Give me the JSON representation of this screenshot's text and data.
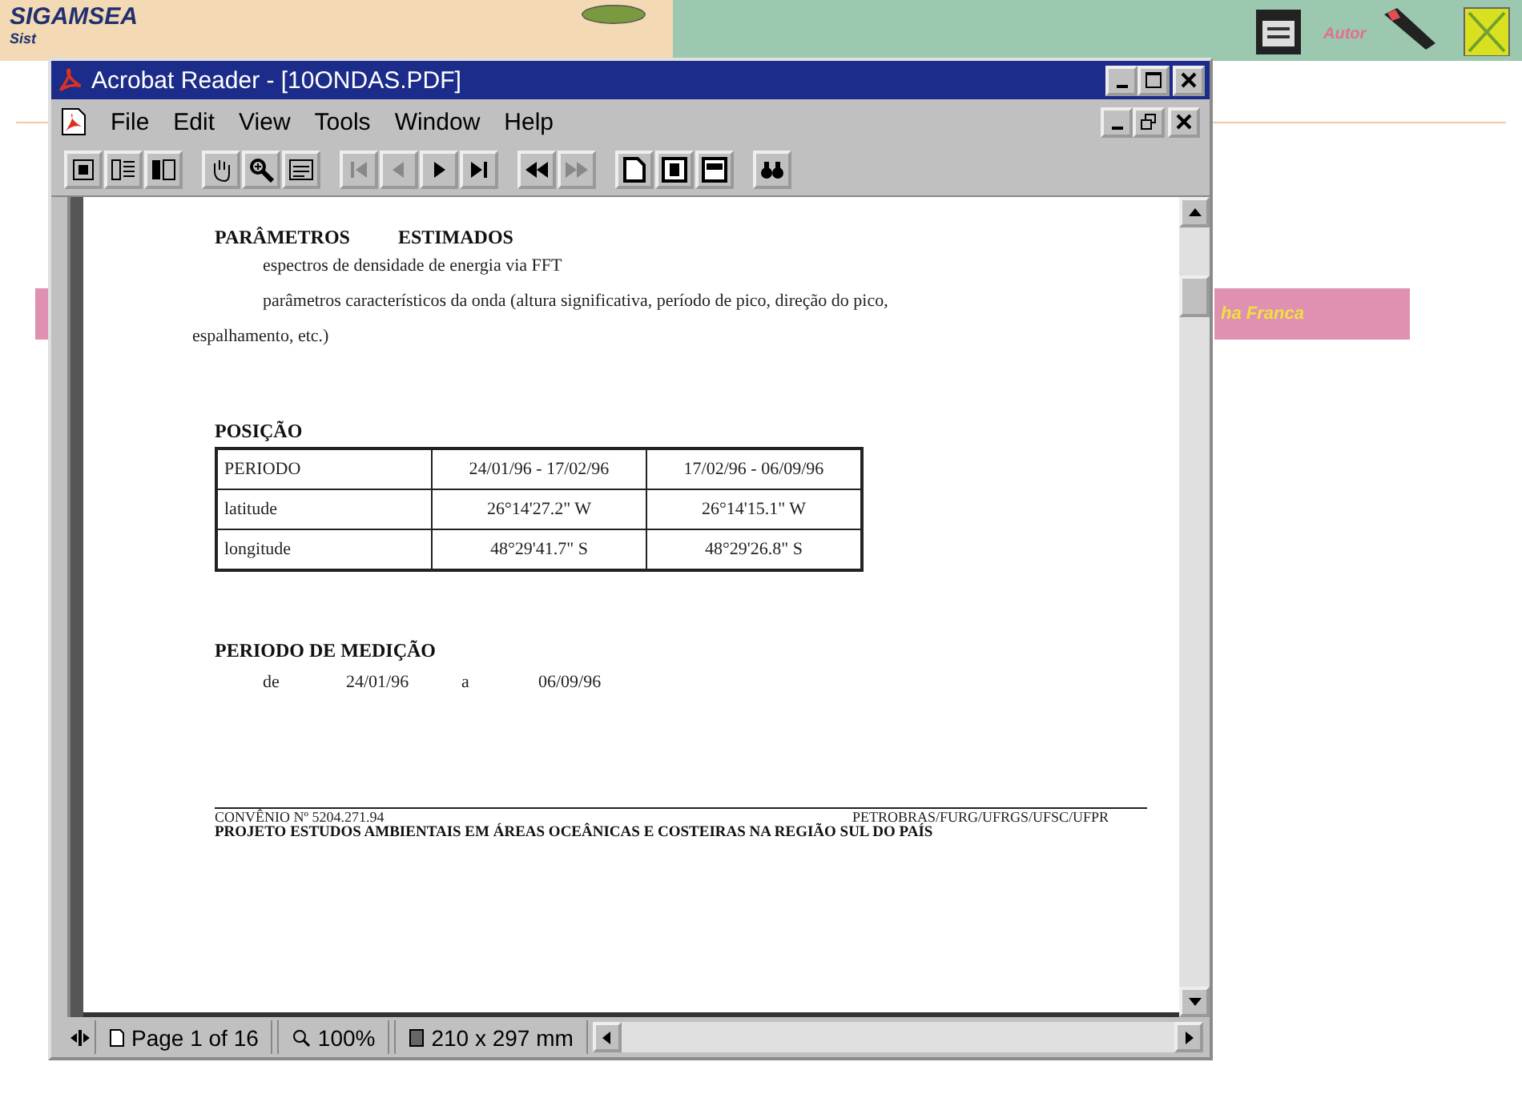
{
  "background_app": {
    "title": "SIGAMSEA",
    "subtitle": "Sist",
    "right_banner": "ha Franca",
    "author_label": "Autor"
  },
  "window": {
    "title": "Acrobat Reader - [10ONDAS.PDF]"
  },
  "menu": [
    "File",
    "Edit",
    "View",
    "Tools",
    "Window",
    "Help"
  ],
  "toolbar": [
    {
      "kind": "page-only",
      "disabled": false
    },
    {
      "kind": "bookmarks",
      "disabled": false
    },
    {
      "kind": "thumbnails",
      "disabled": false
    },
    {
      "kind": "hand",
      "disabled": false
    },
    {
      "kind": "zoom",
      "disabled": false
    },
    {
      "kind": "select-text",
      "disabled": false
    },
    {
      "kind": "first",
      "disabled": true
    },
    {
      "kind": "prev",
      "disabled": true
    },
    {
      "kind": "next",
      "disabled": false
    },
    {
      "kind": "last",
      "disabled": false
    },
    {
      "kind": "back",
      "disabled": false
    },
    {
      "kind": "forward",
      "disabled": true
    },
    {
      "kind": "actual-size",
      "disabled": false
    },
    {
      "kind": "fit-page",
      "disabled": false
    },
    {
      "kind": "fit-width",
      "disabled": false
    },
    {
      "kind": "find",
      "disabled": false
    }
  ],
  "document": {
    "section_1": {
      "heading_1": "PARÂMETROS",
      "heading_2": "ESTIMADOS",
      "line_1": "espectros de densidade de energia via FFT",
      "line_2": "parâmetros característicos da onda (altura significativa, período de pico, direção do pico,",
      "line_3": "espalhamento, etc.)"
    },
    "section_2": {
      "heading": "POSIÇÃO",
      "table": [
        [
          "PERIODO",
          "24/01/96 - 17/02/96",
          "17/02/96 - 06/09/96"
        ],
        [
          "latitude",
          "26°14'27.2\" W",
          "26°14'15.1\" W"
        ],
        [
          "longitude",
          "48°29'41.7\" S",
          "48°29'26.8\" S"
        ]
      ]
    },
    "section_3": {
      "heading": "PERIODO DE MEDIÇÃO",
      "from_label": "de",
      "from": "24/01/96",
      "to_label": "a",
      "to": "06/09/96"
    },
    "footer": {
      "left": "CONVÊNIO  Nº 5204.271.94",
      "right": "PETROBRAS/FURG/UFRGS/UFSC/UFPR",
      "project": "PROJETO ESTUDOS AMBIENTAIS EM  ÁREAS OCEÂNICAS E COSTEIRAS NA REGIÃO SUL DO PAÍS"
    }
  },
  "status_bar": {
    "page": "Page 1 of 16",
    "zoom": "100%",
    "size": "210 x 297 mm"
  }
}
